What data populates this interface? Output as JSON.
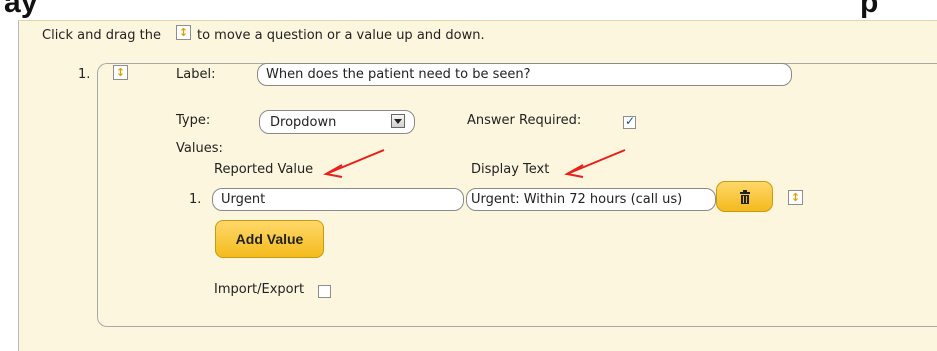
{
  "top_heading": {
    "left": "ay",
    "right": "p"
  },
  "instructions": {
    "before": "Click and drag the",
    "after": "to move a question or a value up and down."
  },
  "question": {
    "number": "1.",
    "label_caption": "Label:",
    "label_value": "When does the patient need to be seen?",
    "type_caption": "Type:",
    "type_value": "Dropdown",
    "answer_required_caption": "Answer Required:",
    "answer_required": true,
    "values_caption": "Values:",
    "reported_value_header": "Reported Value",
    "display_text_header": "Display Text",
    "values": [
      {
        "number": "1.",
        "reported": "Urgent",
        "display": "Urgent:  Within 72 hours (call us)"
      }
    ],
    "add_value_label": "Add Value",
    "import_export_caption": "Import/Export",
    "import_export": false
  },
  "icons": {
    "drag": "drag-handle-icon",
    "trash": "trash-icon",
    "arrow": "red-arrow-annotation"
  },
  "colors": {
    "panel": "#fdf6de",
    "button": "#f4bb1d",
    "annotation": "#e8201a",
    "checkbox": "#1a4fa8"
  }
}
